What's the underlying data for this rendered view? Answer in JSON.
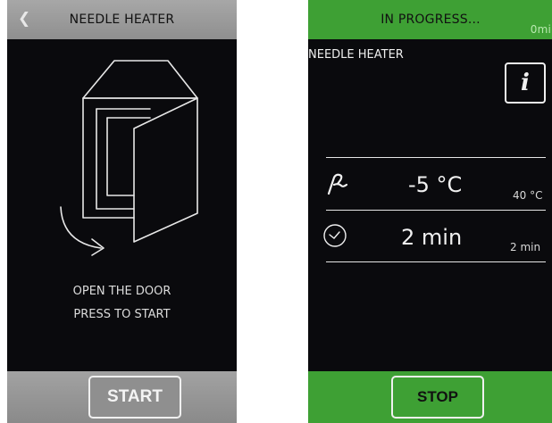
{
  "left_screen": {
    "title": "NEEDLE HEATER",
    "back_icon": "chevron-left-icon",
    "instructions": [
      "OPEN THE DOOR",
      "PRESS TO START"
    ],
    "start_label": "START",
    "illustration": "open-door-illustration"
  },
  "right_screen": {
    "status": "IN PROGRESS...",
    "elapsed": "0mi",
    "title": "NEEDLE HEATER",
    "info_icon": "info-icon",
    "temperature": {
      "icon": "needle-icon",
      "current": "-5 °C",
      "setpoint": "40 °C"
    },
    "time": {
      "icon": "clock-icon",
      "current": "2 min",
      "setpoint": "2 min"
    },
    "stop_label": "STOP"
  },
  "colors": {
    "screen_bg": "#0a0a0d",
    "gray_bar": "#8f8f8f",
    "green_bar": "#3ea034",
    "text_light": "#f0f0f0"
  }
}
